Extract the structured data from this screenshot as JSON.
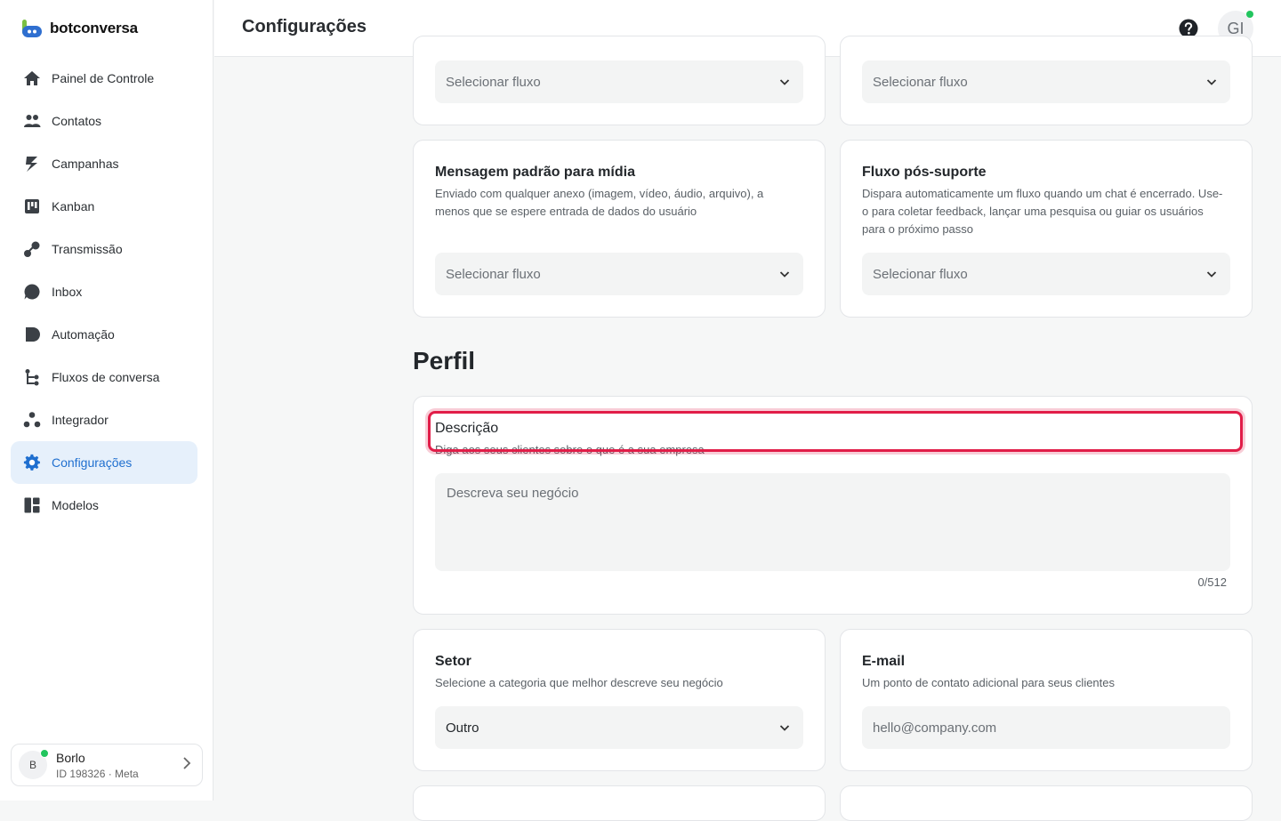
{
  "brand": {
    "name": "botconversa"
  },
  "header": {
    "title": "Configurações",
    "user_initials": "GI"
  },
  "sidebar": {
    "items": [
      {
        "label": "Painel de Controle",
        "icon": "home-icon"
      },
      {
        "label": "Contatos",
        "icon": "users-icon"
      },
      {
        "label": "Campanhas",
        "icon": "campaign-icon"
      },
      {
        "label": "Kanban",
        "icon": "kanban-icon"
      },
      {
        "label": "Transmissão",
        "icon": "broadcast-icon"
      },
      {
        "label": "Inbox",
        "icon": "chat-bubble-icon"
      },
      {
        "label": "Automação",
        "icon": "automation-icon"
      },
      {
        "label": "Fluxos de conversa",
        "icon": "flow-icon"
      },
      {
        "label": "Integrador",
        "icon": "integrator-icon"
      },
      {
        "label": "Configurações",
        "icon": "gear-icon",
        "active": true
      },
      {
        "label": "Modelos",
        "icon": "templates-icon"
      }
    ],
    "account": {
      "initial": "B",
      "name": "Borlo",
      "meta": "ID 198326 · Meta"
    }
  },
  "flows": {
    "top_left_select": "Selecionar fluxo",
    "top_right_select": "Selecionar fluxo",
    "media": {
      "title": "Mensagem padrão para mídia",
      "description": "Enviado com qualquer anexo (imagem, vídeo, áudio, arquivo), a menos que se espere entrada de dados do usuário",
      "select": "Selecionar fluxo"
    },
    "post_support": {
      "title": "Fluxo pós-suporte",
      "description": "Dispara automaticamente um fluxo quando um chat é encerrado. Use-o para coletar feedback, lançar uma pesquisa ou guiar os usuários para o próximo passo",
      "select": "Selecionar fluxo"
    }
  },
  "profile": {
    "section_title": "Perfil",
    "description": {
      "title": "Descrição",
      "subtitle": "Diga aos seus clientes sobre o que é a sua empresa",
      "placeholder": "Descreva seu negócio",
      "counter": "0/512"
    },
    "sector": {
      "title": "Setor",
      "description": "Selecione a categoria que melhor descreve seu negócio",
      "value": "Outro"
    },
    "email": {
      "title": "E-mail",
      "description": "Um ponto de contato adicional para seus clientes",
      "placeholder": "hello@company.com"
    }
  },
  "colors": {
    "accent": "#1f6fcf",
    "active_bg": "#e6f0fb",
    "highlight": "#e11d48",
    "online": "#22c55e"
  }
}
